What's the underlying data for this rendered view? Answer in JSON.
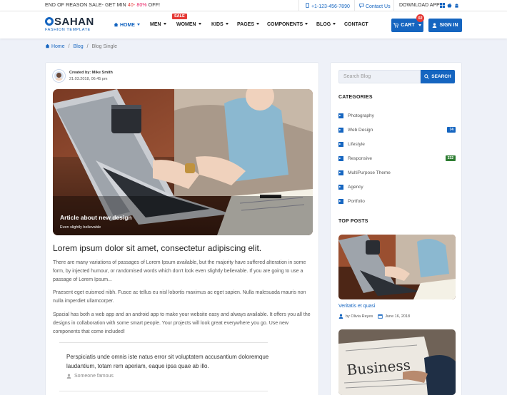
{
  "topbar": {
    "promo_prefix": "END OF REASON SALE- GET MIN ",
    "promo_min": "40-",
    "promo_max": "80%",
    "promo_suffix": " OFF!",
    "phone": "+1-123-456-7890",
    "contact": "Contact Us",
    "download": "DOWNLOAD APP"
  },
  "brand": {
    "name": "SAHAN",
    "tagline": "FASHION TEMPLATE"
  },
  "nav": {
    "items": [
      {
        "label": "HOME"
      },
      {
        "label": "MEN"
      },
      {
        "label": "WOMEN"
      },
      {
        "label": "KIDS"
      },
      {
        "label": "PAGES"
      },
      {
        "label": "COMPONENTS"
      },
      {
        "label": "BLOG"
      },
      {
        "label": "CONTACT"
      }
    ],
    "sale_badge": "SALE",
    "cart_label": "CART",
    "cart_count": "02",
    "signin_label": "SIGN IN"
  },
  "breadcrumb": [
    "Home",
    "Blog",
    "Blog Single"
  ],
  "post": {
    "created_by": "Created by: Mike Smith",
    "date": "21.03.2018, 06:45 pm",
    "image_caption": "Article about new design",
    "image_subcaption": "Even slightly believable",
    "title": "Lorem ipsum dolor sit amet, consectetur adipiscing elit.",
    "paragraphs": [
      "There are many variations of passages of Lorem Ipsum available, but the majority have suffered alteration in some form, by injected humour, or randomised words which don't look even slightly believable. If you are going to use a passage of Lorem Ipsum...",
      "Praesent eget euismod nibh. Fusce ac tellus eu nisl lobortis maximus ac eget sapien. Nulla malesuada mauris non nulla imperdiet ullamcorper.",
      "Spacial has both a web app and an android app to make your website easy and always available. It offers you all the designs in collaboration with some smart people. Your projects will look great everywhere you go. Use new components that come included!"
    ],
    "quote": "Perspiciatis unde omnis iste natus error sit voluptatem accusantium doloremque laudantium, totam rem aperiam, eaque ipsa quae ab illo.",
    "quote_author": "Someone famous"
  },
  "sidebar": {
    "search_placeholder": "Search Blog",
    "search_button": "SEARCH",
    "categories_heading": "CATEGORIES",
    "categories": [
      {
        "label": "Photography",
        "count": ""
      },
      {
        "label": "Web Design",
        "count": "74"
      },
      {
        "label": "Lifestyle",
        "count": ""
      },
      {
        "label": "Responsive",
        "count": "332"
      },
      {
        "label": "MultiPurpose Theme",
        "count": ""
      },
      {
        "label": "Agency",
        "count": ""
      },
      {
        "label": "Portfolio",
        "count": ""
      }
    ],
    "top_posts_heading": "TOP POSTS",
    "top_post": {
      "title": "Veritatis et quasi",
      "author": "by Olivia Reyes",
      "date": "June 16, 2018"
    },
    "second_post_image_text": "Business"
  },
  "colors": {
    "primary": "#1565c0",
    "danger": "#e53935",
    "badge_blue": "#1565c0",
    "badge_green": "#2e7d32",
    "background": "#eef1f8"
  }
}
